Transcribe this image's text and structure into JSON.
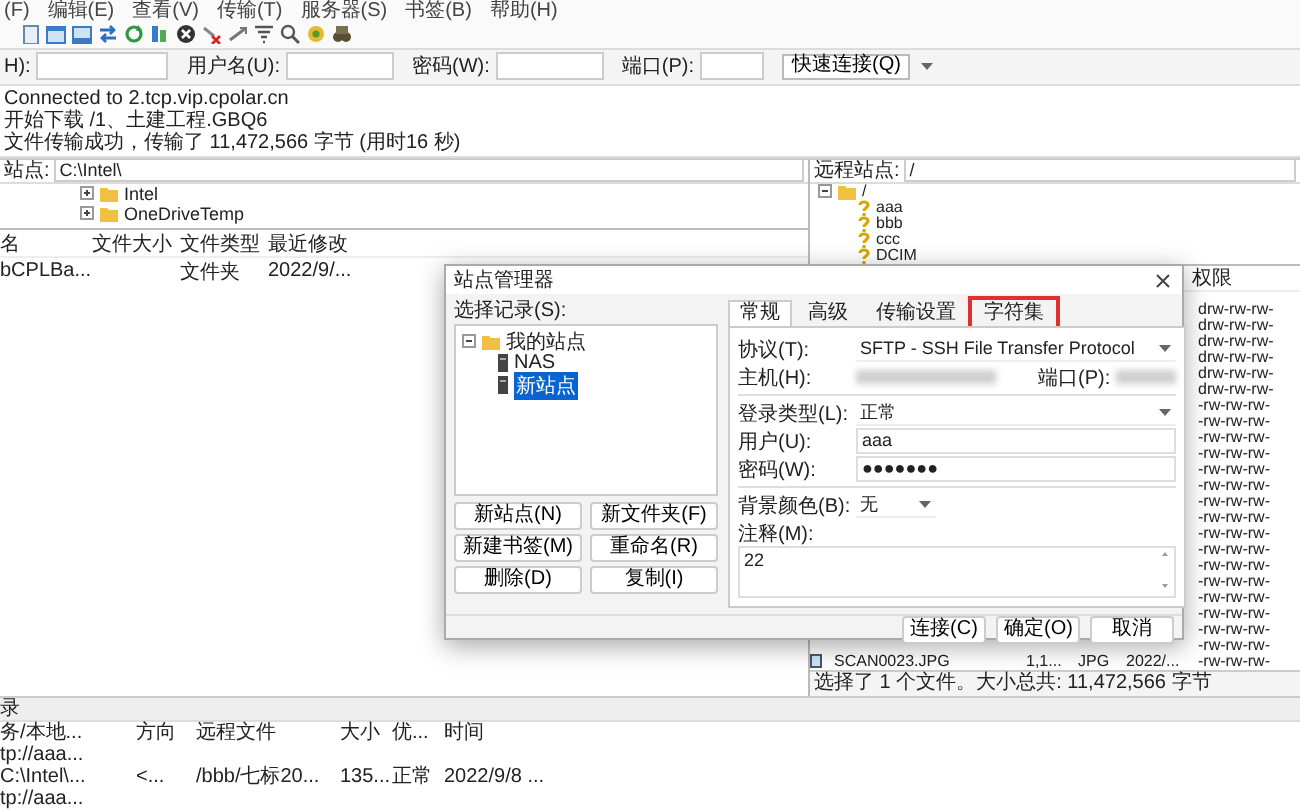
{
  "menu": [
    "(F)",
    "编辑(E)",
    "查看(V)",
    "传输(T)",
    "服务器(S)",
    "书签(B)",
    "帮助(H)"
  ],
  "quickconnect": {
    "fields": [
      {
        "label": "H):"
      },
      {
        "label": "用户名(U):"
      },
      {
        "label": "密码(W):"
      },
      {
        "label": "端口(P):"
      }
    ],
    "button": "快速连接(Q)"
  },
  "log": [
    "Connected to 2.tcp.vip.cpolar.cn",
    "开始下载 /1、土建工程.GBQ6",
    "文件传输成功，传输了 11,472,566 字节 (用时16 秒)"
  ],
  "local": {
    "site_label": "站点:",
    "path": "C:\\Intel\\",
    "tree": [
      {
        "name": "Intel",
        "expanded": false
      },
      {
        "name": "OneDriveTemp",
        "expanded": false
      }
    ],
    "columns": [
      "名",
      "文件大小",
      "文件类型",
      "最近修改"
    ],
    "rows": [
      [
        "bCPLBa...",
        "",
        "文件夹",
        "2022/9/..."
      ]
    ]
  },
  "remote": {
    "site_label": "远程站点:",
    "path": "/",
    "tree": [
      {
        "name": "/",
        "expanded": true,
        "children": [
          {
            "name": "aaa"
          },
          {
            "name": "bbb"
          },
          {
            "name": "ccc"
          },
          {
            "name": "DCIM"
          }
        ]
      }
    ],
    "perms_column": "权限",
    "rows": [
      {
        "perms": "drw-rw-rw-"
      },
      {
        "perms": "drw-rw-rw-"
      },
      {
        "perms": "drw-rw-rw-"
      },
      {
        "perms": "drw-rw-rw-"
      },
      {
        "perms": "drw-rw-rw-"
      },
      {
        "perms": "drw-rw-rw-"
      },
      {
        "perms": "-rw-rw-rw-"
      },
      {
        "perms": "-rw-rw-rw-"
      },
      {
        "perms": "-rw-rw-rw-"
      },
      {
        "perms": "-rw-rw-rw-"
      },
      {
        "perms": "-rw-rw-rw-"
      },
      {
        "perms": "-rw-rw-rw-"
      },
      {
        "perms": "-rw-rw-rw-"
      },
      {
        "perms": "-rw-rw-rw-"
      },
      {
        "perms": "-rw-rw-rw-"
      },
      {
        "perms": "-rw-rw-rw-"
      },
      {
        "perms": "-rw-rw-rw-"
      },
      {
        "perms": "-rw-rw-rw-"
      },
      {
        "perms": "-rw-rw-rw-"
      },
      {
        "perms": "-rw-rw-rw-"
      },
      {
        "perms": "-rw-rw-rw-"
      },
      {
        "perms": "-rw-rw-rw-"
      },
      {
        "name": "SCAN0023.JPG",
        "size": "1,1...",
        "type": "JPG",
        "date": "2022/...",
        "perms": "-rw-rw-rw-"
      }
    ],
    "status": "选择了 1 个文件。大小总共: 11,472,566 字节"
  },
  "queue": {
    "title": "录",
    "columns": [
      "务/本地...",
      "方向",
      "远程文件",
      "大小",
      "优...",
      "时间"
    ],
    "rows": [
      [
        "tp://aaa..."
      ],
      [
        "C:\\Intel\\...",
        "<...",
        "/bbb/七标20...",
        "135...",
        "正常",
        "2022/9/8 ..."
      ],
      [
        "tp://aaa..."
      ]
    ]
  },
  "dialog": {
    "title": "站点管理器",
    "tree_label": "选择记录(S):",
    "tree": [
      {
        "name": "我的站点",
        "expanded": true,
        "selected": false,
        "children": [
          {
            "name": "NAS",
            "selected": false
          },
          {
            "name": "新站点",
            "selected": true
          }
        ]
      }
    ],
    "tree_buttons": [
      "新站点(N)",
      "新文件夹(F)",
      "新建书签(M)",
      "重命名(R)",
      "删除(D)",
      "复制(I)"
    ],
    "tabs": [
      {
        "label": "常规",
        "selected": true,
        "highlighted": false
      },
      {
        "label": "高级",
        "selected": false,
        "highlighted": false
      },
      {
        "label": "传输设置",
        "selected": false,
        "highlighted": false
      },
      {
        "label": "字符集",
        "selected": false,
        "highlighted": true
      }
    ],
    "groups": [
      [
        {
          "kind": "select",
          "label": "协议(T):",
          "value": "SFTP - SSH File Transfer Protocol"
        },
        {
          "kind": "host",
          "label": "主机(H):",
          "port_label": "端口(P):"
        }
      ],
      [
        {
          "kind": "select",
          "label": "登录类型(L):",
          "value": "正常"
        },
        {
          "kind": "text",
          "label": "用户(U):",
          "value": "aaa"
        },
        {
          "kind": "text",
          "label": "密码(W):",
          "value": "●●●●●●●"
        }
      ],
      [
        {
          "kind": "small_select",
          "label": "背景颜色(B):",
          "value": "无"
        },
        {
          "kind": "textarea",
          "label": "注释(M):",
          "value": "22"
        }
      ]
    ],
    "buttons": [
      "连接(C)",
      "确定(O)",
      "取消"
    ]
  }
}
